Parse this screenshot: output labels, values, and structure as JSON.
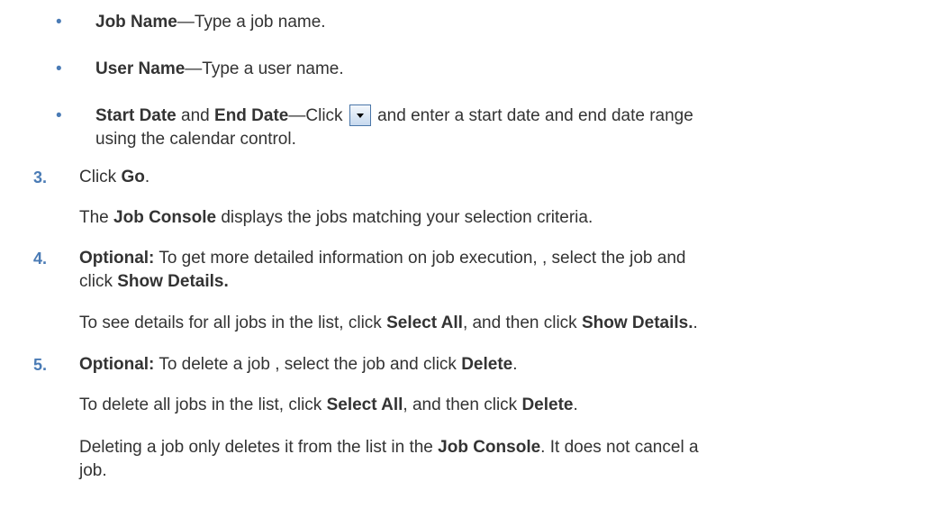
{
  "bullets": [
    {
      "bold": "Job Name",
      "text": "—Type a job name."
    },
    {
      "bold": "User Name",
      "text": "—Type a user name."
    },
    {
      "bold1": "Start Date",
      "mid": " and ",
      "bold2": "End Date",
      "text1": "—Click ",
      "icon": "dropdown-calendar-icon",
      "text2": " and enter a start date and end date range",
      "line2": "using the calendar control."
    }
  ],
  "steps": [
    {
      "num": "3.",
      "a": "Click ",
      "b": "Go",
      "c": ".",
      "p1": {
        "a": "The ",
        "b": "Job Console",
        "c": " displays the jobs matching your selection criteria."
      }
    },
    {
      "num": "4.",
      "b0": "Optional:",
      "a": " To get more detailed information on job execution, , select the job and",
      "line2a": "click ",
      "line2b": "Show Details.",
      "p1": {
        "a": "To see details for all jobs in the list, click ",
        "b": "Select All",
        "c": ", and then click ",
        "d": "Show Details.",
        "e": "."
      }
    },
    {
      "num": "5.",
      "b0": "Optional:",
      "a": " To delete a job , select the job and click ",
      "b": "Delete",
      "c": ".",
      "p1": {
        "a": "To delete all jobs in the list, click ",
        "b": "Select All",
        "c": ", and then click ",
        "d": "Delete",
        "e": "."
      },
      "p2": {
        "a": "Deleting a job only deletes it from the list in the ",
        "b": "Job Console",
        "c": ". It does not cancel a",
        "line2": "job."
      }
    }
  ],
  "colors": {
    "text": "#333333",
    "accent": "#4a7bb5"
  }
}
